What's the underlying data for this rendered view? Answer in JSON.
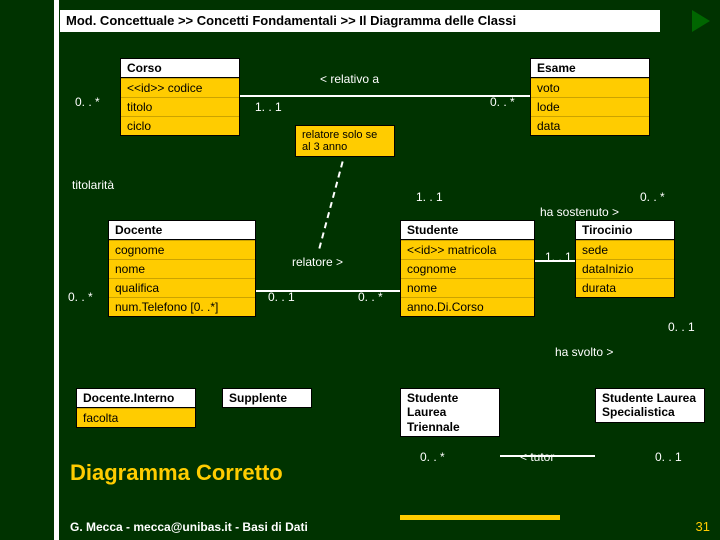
{
  "breadcrumb": "Mod. Concettuale >> Concetti Fondamentali >> Il Diagramma delle Classi",
  "classes": {
    "corso": {
      "name": "Corso",
      "attrs": [
        "<<id>> codice",
        "titolo",
        "ciclo"
      ]
    },
    "esame": {
      "name": "Esame",
      "attrs": [
        "voto",
        "lode",
        "data"
      ]
    },
    "docente": {
      "name": "Docente",
      "attrs": [
        "cognome",
        "nome",
        "qualifica",
        "num.Telefono [0. .*]"
      ]
    },
    "studente": {
      "name": "Studente",
      "attrs": [
        "<<id>> matricola",
        "cognome",
        "nome",
        "anno.Di.Corso"
      ]
    },
    "tirocinio": {
      "name": "Tirocinio",
      "attrs": [
        "sede",
        "dataInizio",
        "durata"
      ]
    },
    "docenteInterno": {
      "name": "Docente.Interno",
      "attrs": [
        "facolta"
      ]
    },
    "supplente": {
      "name": "Supplente"
    },
    "sLaureaT": {
      "name": "Studente Laurea Triennale"
    },
    "sLaureaS": {
      "name": "Studente Laurea Specialistica"
    }
  },
  "assoc": {
    "relativo": "< relativo a",
    "relSolo": "relatore solo se al 3 anno",
    "titolarita": "titolarità",
    "relatore": "relatore >",
    "sostenuto": "ha sostenuto >",
    "svolto": "ha svolto >",
    "tutor": "< tutor"
  },
  "mult": {
    "m0s": "0. . *",
    "m11": "1. . 1",
    "m01": "0. . 1"
  },
  "title": "Diagramma Corretto",
  "footer": "G. Mecca - mecca@unibas.it - Basi di Dati",
  "page": "31"
}
